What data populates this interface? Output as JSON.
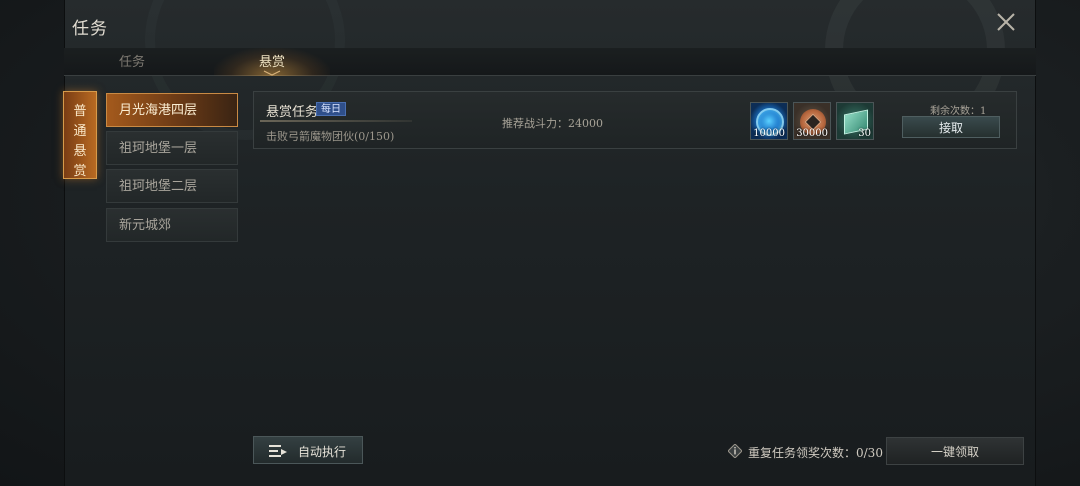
{
  "window": {
    "title": "任务"
  },
  "tabs": [
    {
      "label": "任务",
      "active": false
    },
    {
      "label": "悬赏",
      "active": true
    }
  ],
  "category": {
    "label": "普通悬赏"
  },
  "levels": [
    {
      "label": "月光海港四层",
      "active": true
    },
    {
      "label": "祖珂地堡一层",
      "active": false
    },
    {
      "label": "祖珂地堡二层",
      "active": false
    },
    {
      "label": "新元城郊",
      "active": false
    }
  ],
  "quest": {
    "title": "悬赏任务",
    "badge": "每日",
    "description": "击败弓箭魔物团伙(0/150)",
    "power": "推荐战斗力：24000",
    "remaining": "剩余次数：1",
    "accept_label": "接取",
    "rewards": [
      {
        "icon": "blue-orb-icon",
        "qty": "10000"
      },
      {
        "icon": "copper-coin-icon",
        "qty": "30000"
      },
      {
        "icon": "skill-book-icon",
        "qty": "30"
      }
    ]
  },
  "footer": {
    "auto_label": "自动执行",
    "repeat_text": "重复任务领奖次数：0/30",
    "collect_label": "一键领取"
  },
  "colors": {
    "accent": "#b86a22",
    "badge": "#2f4f8a"
  }
}
